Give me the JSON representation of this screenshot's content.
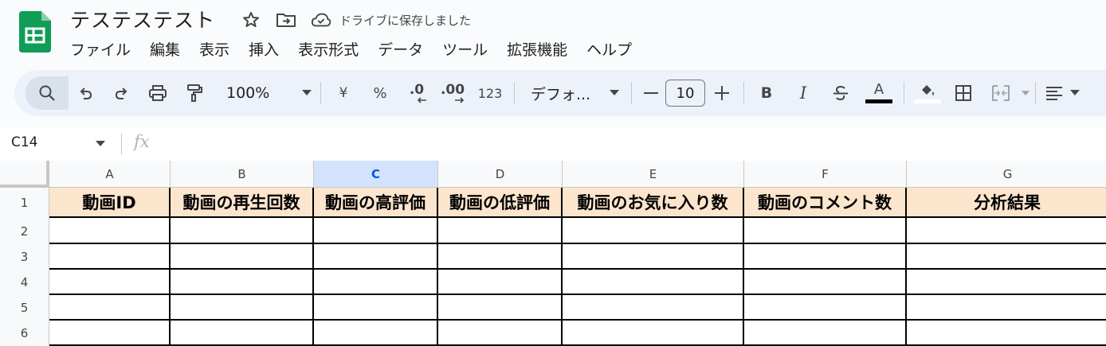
{
  "app": {
    "title": "テステステスト",
    "save_status": "ドライブに保存しました",
    "brand_color": "#0f9d58"
  },
  "menu": [
    "ファイル",
    "編集",
    "表示",
    "挿入",
    "表示形式",
    "データ",
    "ツール",
    "拡張機能",
    "ヘルプ"
  ],
  "toolbar": {
    "zoom": "100%",
    "currency": "¥",
    "percent": "%",
    "decrease_decimal": ".0",
    "increase_decimal": ".00",
    "number_format": "123",
    "font": "デフォ...",
    "font_size": "10",
    "bold": "B",
    "italic": "I",
    "text_color": "A"
  },
  "formula_bar": {
    "name_box": "C14",
    "fx": "fx"
  },
  "sheet": {
    "columns": [
      "A",
      "B",
      "C",
      "D",
      "E",
      "F",
      "G"
    ],
    "selected_column": "C",
    "rows": [
      "1",
      "2",
      "3",
      "4",
      "5",
      "6"
    ],
    "header_row": [
      "動画ID",
      "動画の再生回数",
      "動画の高評価",
      "動画の低評価",
      "動画のお気に入り数",
      "動画のコメント数",
      "分析結果"
    ],
    "header_fill": "#fce5cd"
  }
}
